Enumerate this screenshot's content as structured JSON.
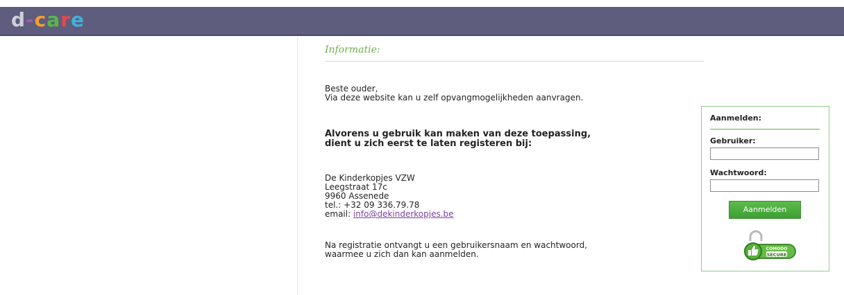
{
  "app": {
    "logo_parts": [
      "d",
      "-",
      "c",
      "a",
      "r",
      "e"
    ]
  },
  "info": {
    "heading": "Informatie:",
    "greeting": "Beste ouder,",
    "intro": "Via deze website kan u zelf opvangmogelijkheden aanvragen.",
    "notice_line1": "Alvorens u gebruik kan maken van deze toepassing,",
    "notice_line2": "dient u zich eerst te laten registeren bij:",
    "contact": {
      "name": "De Kinderkopjes VZW",
      "street": "Leegstraat 17c",
      "city": "9960 Assenede",
      "phone": "tel.: +32 09 336.79.78",
      "email_prefix": "email: ",
      "email": "info@dekinderkopjes.be"
    },
    "outro_line1": "Na registratie ontvangt u een gebruikersnaam en wachtwoord,",
    "outro_line2": "waarmee u zich dan kan aanmelden."
  },
  "login": {
    "title": "Aanmelden:",
    "username_label": "Gebruiker:",
    "username_value": "",
    "password_label": "Wachtwoord:",
    "password_value": "",
    "submit_label": "Aanmelden"
  },
  "badge": {
    "brand": "COMODO",
    "text": "SECURE",
    "icon": "thumbs-up-icon"
  },
  "colors": {
    "topbar": "#5f5d7e",
    "accent_green": "#6ab04c",
    "link": "#7b3fa0"
  }
}
